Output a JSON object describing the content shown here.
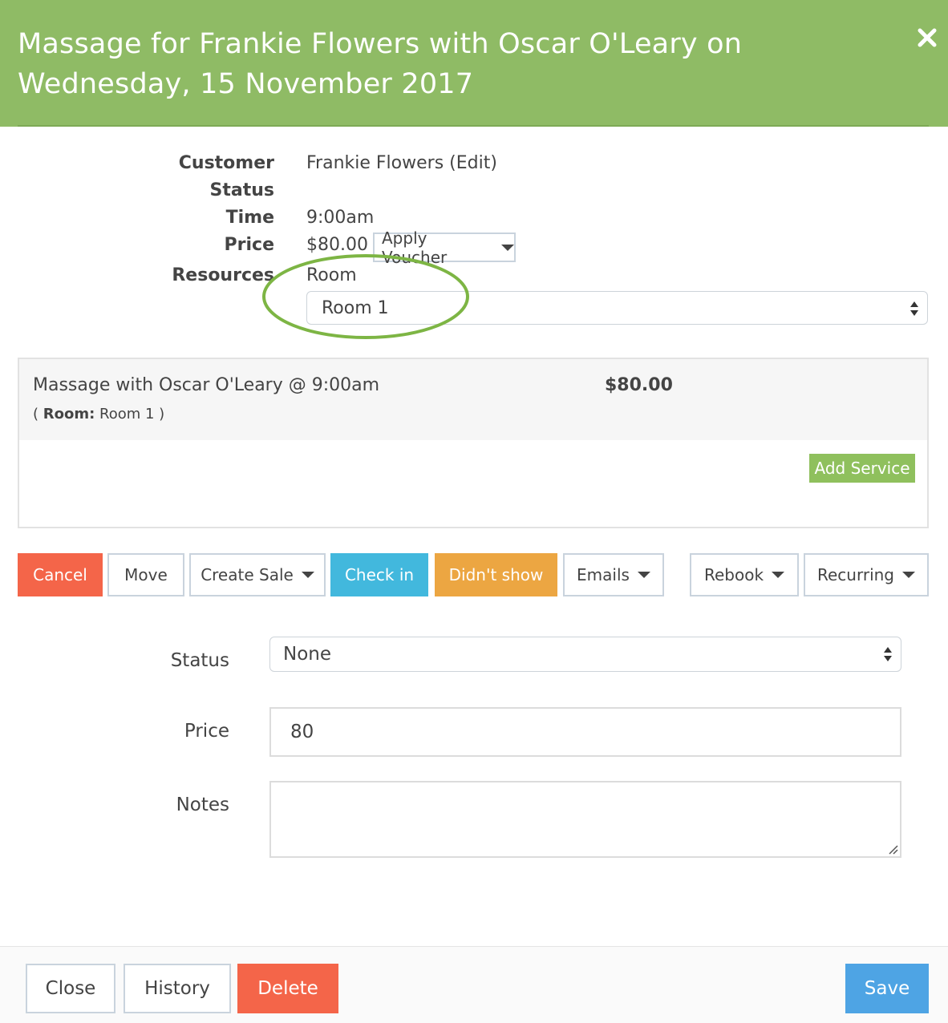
{
  "header": {
    "title": "Massage for Frankie Flowers with Oscar O'Leary on Wednesday, 15 November 2017",
    "close_icon": "close-icon"
  },
  "details": {
    "customer_label": "Customer",
    "customer_value": "Frankie Flowers (Edit)",
    "status_label": "Status",
    "time_label": "Time",
    "time_value": "9:00am",
    "price_label": "Price",
    "price_value": "$80.00",
    "apply_voucher_label": "Apply Voucher",
    "resources_label": "Resources",
    "resource_type": "Room",
    "room_selected": "Room 1"
  },
  "service": {
    "name": "Massage with Oscar O'Leary @ 9:00am",
    "room_prefix": "( ",
    "room_key": "Room:",
    "room_value": " Room 1 )",
    "price": "$80.00",
    "add_service_label": "Add Service"
  },
  "actions": {
    "cancel": "Cancel",
    "move": "Move",
    "create_sale": "Create Sale",
    "check_in": "Check in",
    "didnt_show": "Didn't show",
    "emails": "Emails",
    "rebook": "Rebook",
    "recurring": "Recurring"
  },
  "form": {
    "status_label": "Status",
    "status_value": "None",
    "price_label": "Price",
    "price_value": "80",
    "notes_label": "Notes",
    "notes_value": ""
  },
  "footer": {
    "close": "Close",
    "history": "History",
    "delete": "Delete",
    "save": "Save"
  },
  "colors": {
    "header": "#8fbb65",
    "cancel": "#f46549",
    "check_in": "#42b8dd",
    "didnt_show": "#eca642",
    "add_service": "#8fc05d",
    "save": "#4ea4e4",
    "highlight_ring": "#7db544"
  }
}
